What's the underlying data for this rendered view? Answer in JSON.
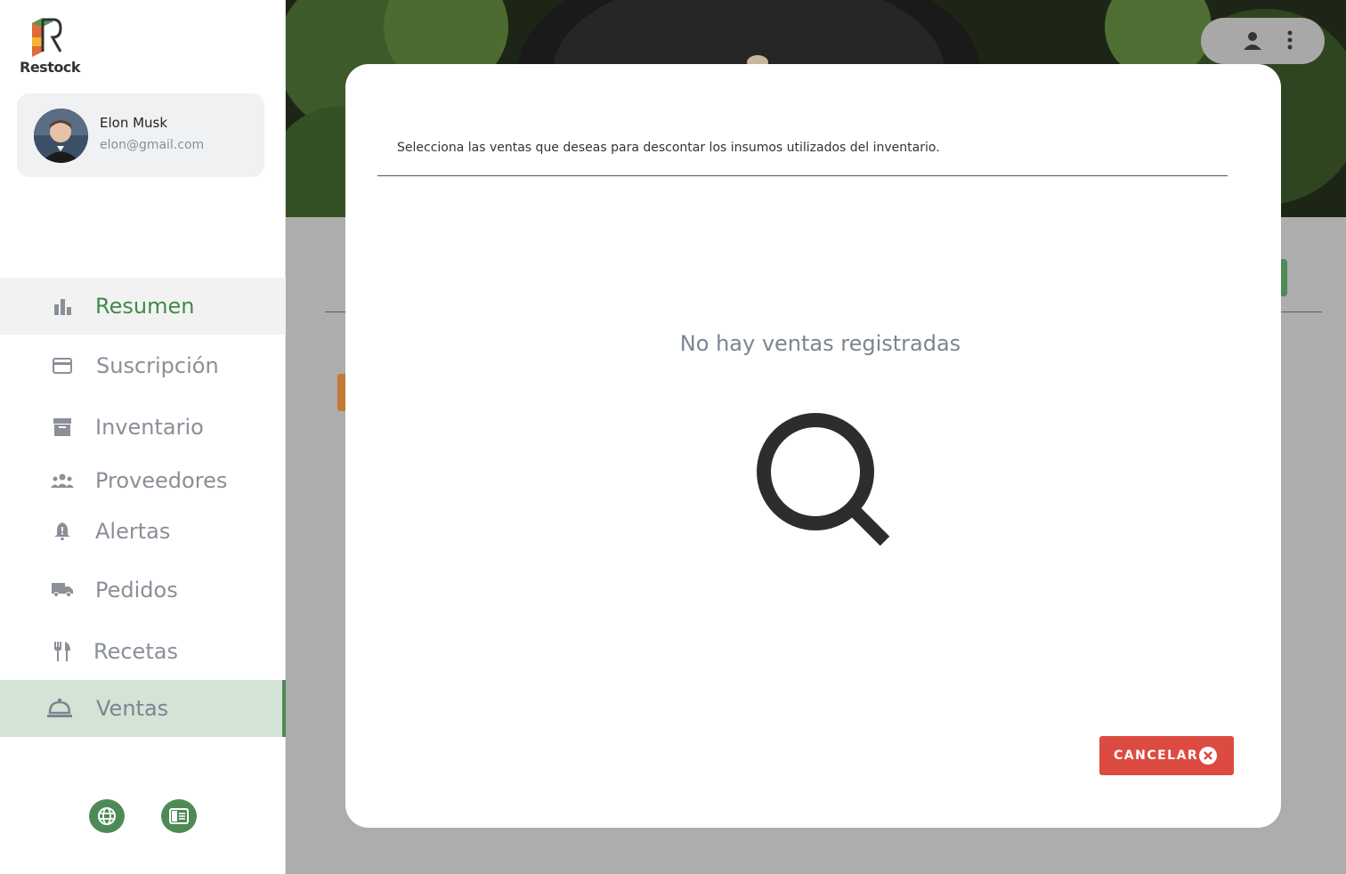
{
  "app": {
    "name": "Restock"
  },
  "profile": {
    "name": "Elon Musk",
    "email": "elon@gmail.com"
  },
  "sidebar": {
    "items": [
      {
        "label": "Resumen",
        "icon": "bar-chart-icon",
        "state": "hover"
      },
      {
        "label": "Suscripción",
        "icon": "credit-card-icon",
        "state": "normal"
      },
      {
        "label": "Inventario",
        "icon": "archive-icon",
        "state": "normal"
      },
      {
        "label": "Proveedores",
        "icon": "people-icon",
        "state": "normal"
      },
      {
        "label": "Alertas",
        "icon": "bell-alert-icon",
        "state": "normal"
      },
      {
        "label": "Pedidos",
        "icon": "truck-icon",
        "state": "normal"
      },
      {
        "label": "Recetas",
        "icon": "fork-knife-icon",
        "state": "normal"
      },
      {
        "label": "Ventas",
        "icon": "room-service-bell-icon",
        "state": "active"
      }
    ],
    "footer_icons": [
      "globe-icon",
      "book-icon"
    ]
  },
  "modal": {
    "description": "Selecciona las ventas que deseas para descontar los insumos utilizados del inventario.",
    "empty_message": "No hay ventas registradas",
    "cancel_label": "CANCELAR"
  },
  "colors": {
    "brand_green": "#4d8a55",
    "active_bg": "#d3e3d5",
    "cancel_red": "#dc4b41",
    "muted_text": "#7b8590"
  }
}
